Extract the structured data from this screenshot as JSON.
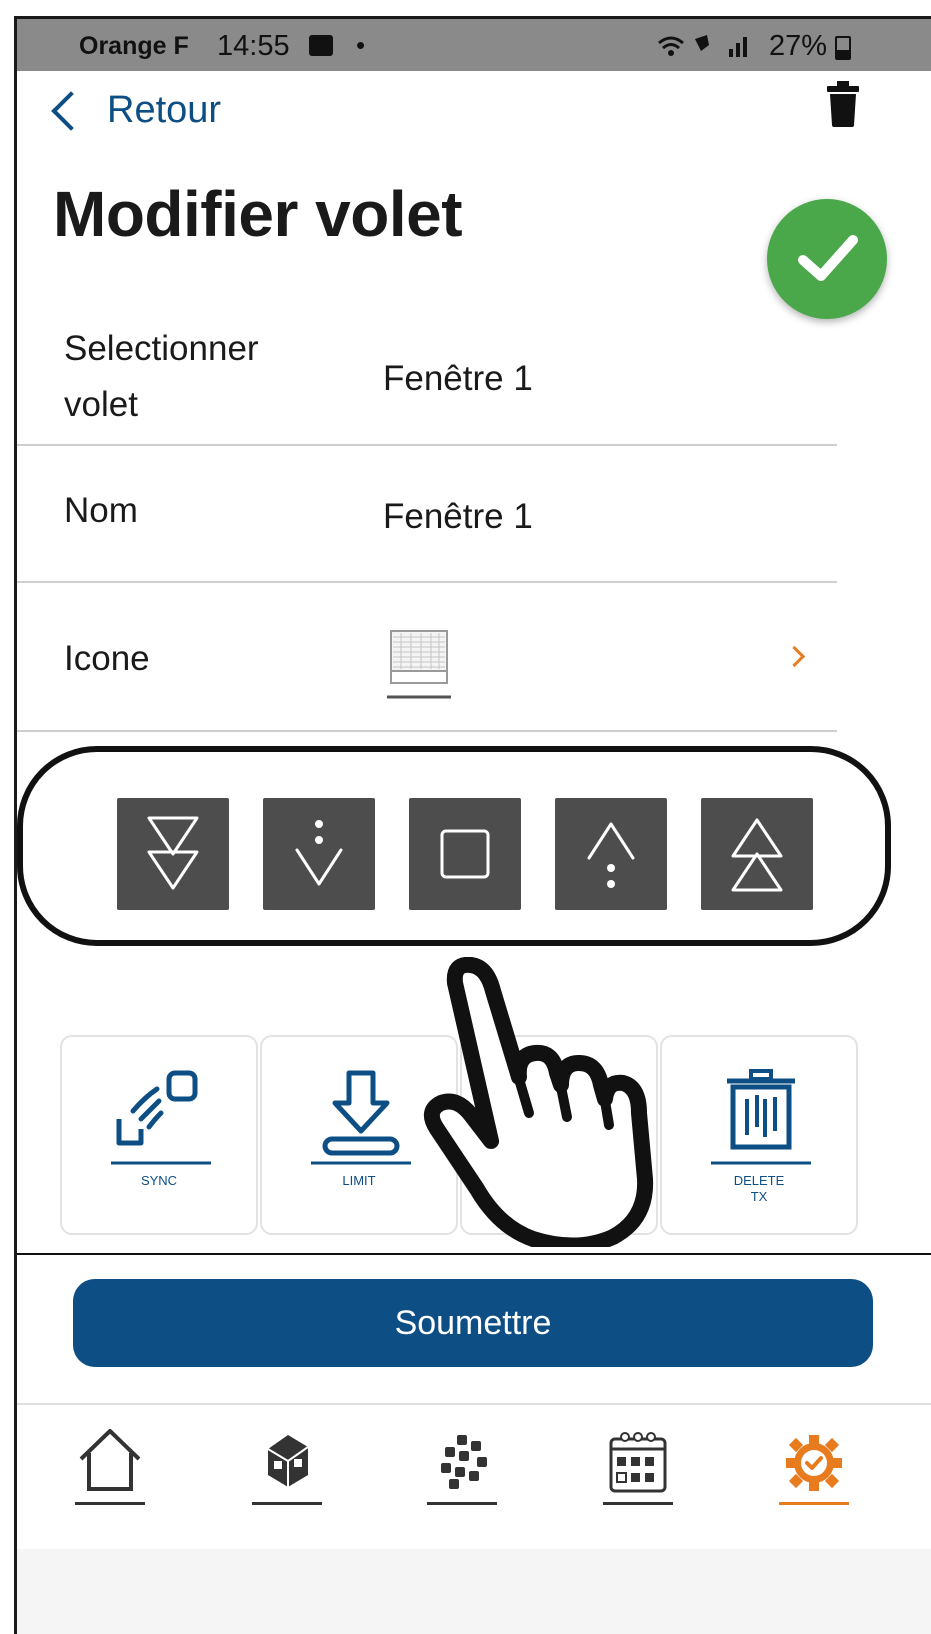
{
  "status_bar": {
    "carrier": "Orange F",
    "time": "14:55",
    "dot": "•",
    "battery": "27%"
  },
  "header": {
    "back_label": "Retour",
    "title": "Modifier volet"
  },
  "form": {
    "select_label": "Selectionner volet",
    "select_value": "Fenêtre 1",
    "name_label": "Nom",
    "name_value": "Fenêtre 1",
    "icon_label": "Icone"
  },
  "controls": [
    "full-down-icon",
    "step-down-icon",
    "stop-icon",
    "step-up-icon",
    "full-up-icon"
  ],
  "tiles": [
    {
      "caption": "SYNC"
    },
    {
      "caption": "LIMIT"
    },
    {
      "caption": ""
    },
    {
      "caption": "DELETE\nTX"
    }
  ],
  "submit_label": "Soumettre",
  "nav": [
    "home-icon",
    "house-3d-icon",
    "devices-icon",
    "calendar-icon",
    "settings-icon"
  ],
  "colors": {
    "primary": "#0d4f84",
    "accent": "#e87b1e",
    "success": "#4aa84a",
    "control_bg": "#4d4d4d"
  }
}
